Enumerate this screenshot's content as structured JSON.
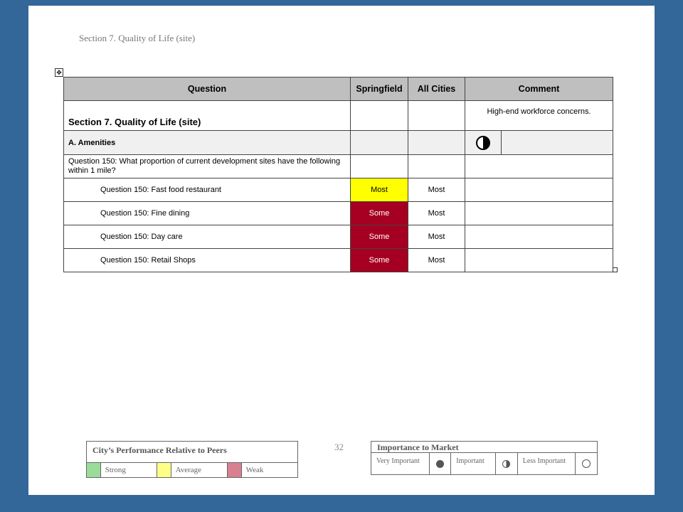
{
  "page": {
    "header": "Section 7. Quality of Life (site)",
    "page_number": "32"
  },
  "table": {
    "headers": {
      "question": "Question",
      "city": "Springfield",
      "all": "All Cities",
      "comment": "Comment"
    },
    "section_title": "Section 7. Quality of Life (site)",
    "section_comment": "High-end workforce concerns.",
    "subsection_title": "A. Amenities",
    "subsection_importance_icon": "half-circle-icon",
    "question_text": "Question 150: What proportion of current development sites have the following within 1 mile?",
    "rows": [
      {
        "question": "Question 150: Fast food restaurant",
        "city": "Most",
        "all": "Most",
        "rating": "average",
        "color": "#ffff00"
      },
      {
        "question": "Question 150: Fine dining",
        "city": "Some",
        "all": "Most",
        "rating": "weak",
        "color": "#a50021"
      },
      {
        "question": "Question 150: Day care",
        "city": "Some",
        "all": "Most",
        "rating": "weak",
        "color": "#a50021"
      },
      {
        "question": "Question 150: Retail Shops",
        "city": "Some",
        "all": "Most",
        "rating": "weak",
        "color": "#a50021"
      }
    ]
  },
  "legend_performance": {
    "title": "City’s Performance Relative to Peers",
    "items": [
      {
        "label": "Strong",
        "color": "#99dd99"
      },
      {
        "label": "Average",
        "color": "#ffff88"
      },
      {
        "label": "Weak",
        "color": "#d98090"
      }
    ]
  },
  "legend_importance": {
    "title": "Importance to Market",
    "items": [
      {
        "label": "Very Important",
        "icon": "full-circle-icon"
      },
      {
        "label": "Important",
        "icon": "half-circle-icon"
      },
      {
        "label": "Less Important",
        "icon": "empty-circle-icon"
      }
    ]
  }
}
